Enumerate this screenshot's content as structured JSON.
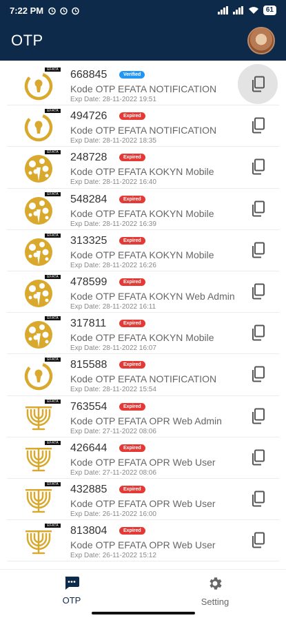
{
  "status_bar": {
    "time": "7:22 PM",
    "battery": "61"
  },
  "app_bar": {
    "title": "OTP"
  },
  "items": [
    {
      "code": "668845",
      "badge": "Verified",
      "badge_type": "verified",
      "desc": "Kode OTP EFATA NOTIFICATION",
      "exp": "Exp Date: 28-11-2022 19:51",
      "logo": "lock-logo-icon"
    },
    {
      "code": "494726",
      "badge": "Expired",
      "badge_type": "expired",
      "desc": "Kode OTP EFATA NOTIFICATION",
      "exp": "Exp Date: 28-11-2022 18:35",
      "logo": "lock-logo-icon"
    },
    {
      "code": "248728",
      "badge": "Expired",
      "badge_type": "expired",
      "desc": "Kode OTP EFATA KOKYN Mobile",
      "exp": "Exp Date: 28-11-2022 16:40",
      "logo": "tree-logo-icon"
    },
    {
      "code": "548284",
      "badge": "Expired",
      "badge_type": "expired",
      "desc": "Kode OTP EFATA KOKYN Mobile",
      "exp": "Exp Date: 28-11-2022 16:39",
      "logo": "tree-logo-icon"
    },
    {
      "code": "313325",
      "badge": "Expired",
      "badge_type": "expired",
      "desc": "Kode OTP EFATA KOKYN Mobile",
      "exp": "Exp Date: 28-11-2022 16:26",
      "logo": "tree-logo-icon"
    },
    {
      "code": "478599",
      "badge": "Expired",
      "badge_type": "expired",
      "desc": "Kode OTP EFATA KOKYN Web Admin",
      "exp": "Exp Date: 28-11-2022 16:11",
      "logo": "tree-logo-icon"
    },
    {
      "code": "317811",
      "badge": "Expired",
      "badge_type": "expired",
      "desc": "Kode OTP EFATA KOKYN Mobile",
      "exp": "Exp Date: 28-11-2022 16:07",
      "logo": "tree-logo-icon"
    },
    {
      "code": "815588",
      "badge": "Expired",
      "badge_type": "expired",
      "desc": "Kode OTP EFATA NOTIFICATION",
      "exp": "Exp Date: 28-11-2022 15:54",
      "logo": "lock-logo-icon"
    },
    {
      "code": "763554",
      "badge": "Expired",
      "badge_type": "expired",
      "desc": "Kode OTP EFATA OPR Web Admin",
      "exp": "Exp Date: 27-11-2022 08:06",
      "logo": "menorah-logo-icon"
    },
    {
      "code": "426644",
      "badge": "Expired",
      "badge_type": "expired",
      "desc": "Kode OTP EFATA OPR Web User",
      "exp": "Exp Date: 27-11-2022 08:06",
      "logo": "menorah-logo-icon"
    },
    {
      "code": "432885",
      "badge": "Expired",
      "badge_type": "expired",
      "desc": "Kode OTP EFATA OPR Web User",
      "exp": "Exp Date: 26-11-2022 16:00",
      "logo": "menorah-logo-icon"
    },
    {
      "code": "813804",
      "badge": "Expired",
      "badge_type": "expired",
      "desc": "Kode OTP EFATA OPR Web User",
      "exp": "Exp Date: 26-11-2022 15:12",
      "logo": "menorah-logo-icon"
    }
  ],
  "logo_tag": "EFATA",
  "bottom_nav": {
    "otp_label": "OTP",
    "setting_label": "Setting"
  },
  "colors": {
    "primary": "#0e2a4a",
    "gold": "#d9a92e",
    "verified": "#2196f3",
    "expired": "#e53935"
  }
}
